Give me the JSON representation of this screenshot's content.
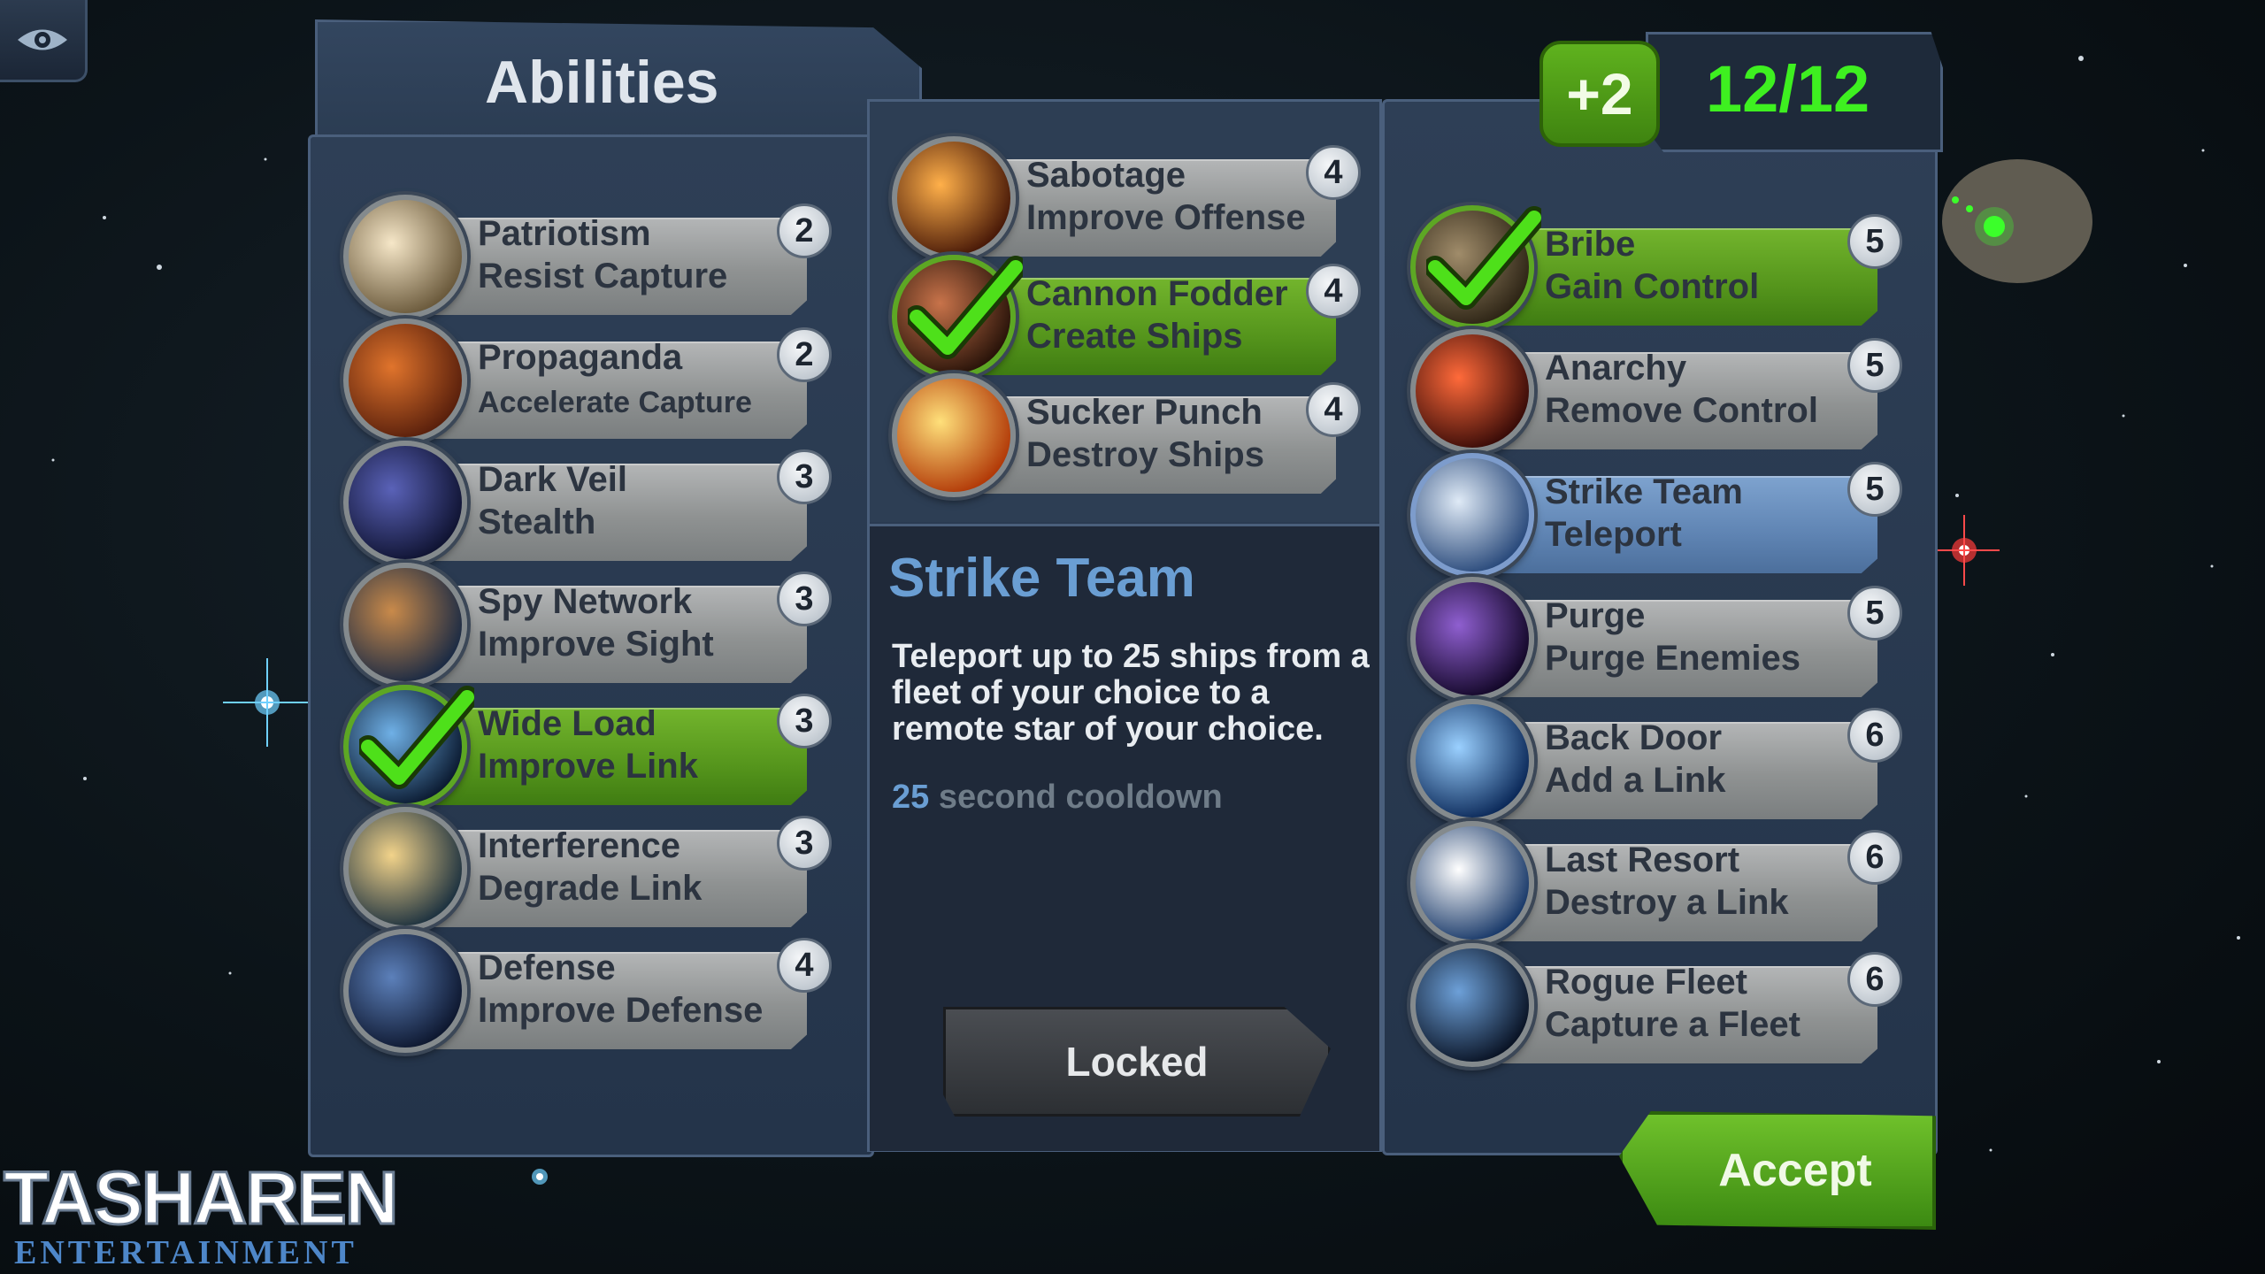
{
  "panel_title": "Abilities",
  "points": {
    "bonus": "+2",
    "used": "12/12"
  },
  "left_column": [
    {
      "name": "Patriotism",
      "desc": "Resist Capture",
      "cost": "2",
      "state": "off",
      "icon": "planet-flare-icon"
    },
    {
      "name": "Propaganda",
      "desc": "Accelerate Capture",
      "cost": "2",
      "state": "off",
      "icon": "red-planet-icon"
    },
    {
      "name": "Dark Veil",
      "desc": "Stealth",
      "cost": "3",
      "state": "off",
      "icon": "nebula-icon"
    },
    {
      "name": "Spy Network",
      "desc": "Improve Sight",
      "cost": "3",
      "state": "off",
      "icon": "satellite-icon"
    },
    {
      "name": "Wide Load",
      "desc": "Improve Link",
      "cost": "3",
      "state": "on",
      "icon": "link-icon"
    },
    {
      "name": "Interference",
      "desc": "Degrade Link",
      "cost": "3",
      "state": "off",
      "icon": "comet-icon"
    },
    {
      "name": "Defense",
      "desc": "Improve Defense",
      "cost": "4",
      "state": "off",
      "icon": "ship-icon"
    }
  ],
  "middle_column": [
    {
      "name": "Sabotage",
      "desc": "Improve Offense",
      "cost": "4",
      "state": "off",
      "icon": "explosion-icon"
    },
    {
      "name": "Cannon Fodder",
      "desc": "Create Ships",
      "cost": "4",
      "state": "on",
      "icon": "shipyard-icon"
    },
    {
      "name": "Sucker Punch",
      "desc": "Destroy Ships",
      "cost": "4",
      "state": "off",
      "icon": "blast-icon"
    }
  ],
  "right_column": [
    {
      "name": "Bribe",
      "desc": "Gain Control",
      "cost": "5",
      "state": "on",
      "icon": "asteroid-icon"
    },
    {
      "name": "Anarchy",
      "desc": "Remove Control",
      "cost": "5",
      "state": "off",
      "icon": "fire-icon"
    },
    {
      "name": "Strike Team",
      "desc": "Teleport",
      "cost": "5",
      "state": "selected",
      "icon": "galaxy-icon"
    },
    {
      "name": "Purge",
      "desc": "Purge Enemies",
      "cost": "5",
      "state": "off",
      "icon": "purge-icon"
    },
    {
      "name": "Back Door",
      "desc": "Add a Link",
      "cost": "6",
      "state": "off",
      "icon": "wormhole-icon"
    },
    {
      "name": "Last Resort",
      "desc": "Destroy a Link",
      "cost": "6",
      "state": "off",
      "icon": "meteor-icon"
    },
    {
      "name": "Rogue Fleet",
      "desc": "Capture a Fleet",
      "cost": "6",
      "state": "off",
      "icon": "fleet-icon"
    }
  ],
  "details": {
    "title": "Strike Team",
    "text": "Teleport up to 25 ships from a fleet of your choice to a remote star of your choice.",
    "cooldown_value": "25",
    "cooldown_label": "second cooldown",
    "button": "Locked"
  },
  "accept_label": "Accept",
  "logo": {
    "line1": "TASHAREN",
    "line2": "ENTERTAINMENT"
  },
  "colors": {
    "active": "#5da724",
    "selected": "#6a9ed3",
    "inactive": "#9a9c9d",
    "points": "#3ef020"
  }
}
